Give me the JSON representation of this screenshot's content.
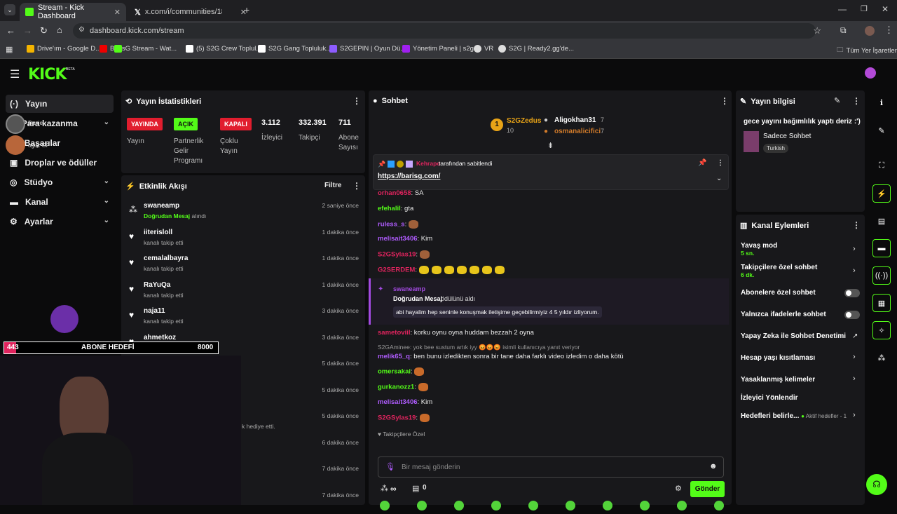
{
  "browser": {
    "tabs": [
      {
        "title": "Stream - Kick Dashboard",
        "active": true
      },
      {
        "title": "x.com/i/communities/18353197",
        "active": false
      }
    ],
    "url": "dashboard.kick.com/stream",
    "bookmarks": [
      "Drive'ım - Google D...",
      "BarisG Stream - Wat...",
      "(5) S2G Crew Toplul...",
      "S2G Gang Topluluk...",
      "S2GEPIN | Oyun Dü...",
      "Yönetim Paneli | s2g...",
      "VR",
      "S2G | Ready2.gg'de..."
    ],
    "all_bookmarks": "Tüm Yer İşaretleri"
  },
  "brand": {
    "logo": "KICK",
    "beta": "BETA",
    "accent": "#53fc18"
  },
  "sidebar": {
    "items": [
      {
        "label": "Yayın"
      },
      {
        "label": "Para kazanma"
      },
      {
        "label": "Başarılar"
      },
      {
        "label": "Droplar ve ödüller"
      },
      {
        "label": "Stüdyo"
      },
      {
        "label": "Kanal"
      },
      {
        "label": "Ayarlar"
      }
    ],
    "overlay_names": [
      "Daniel",
      "oguz GF"
    ]
  },
  "stats": {
    "title": "Yayın İstatistikleri",
    "badges": [
      {
        "value": "YAYINDA",
        "label": "Yayın",
        "color": "#e11d2e"
      },
      {
        "value": "AÇIK",
        "label": "Partnerlik Gelir Programı",
        "color": "#53fc18"
      },
      {
        "value": "KAPALI",
        "label": "Çoklu Yayın",
        "color": "#e11d2e"
      }
    ],
    "numbers": [
      {
        "value": "3.112",
        "label": "İzleyici"
      },
      {
        "value": "332.391",
        "label": "Takipçi"
      },
      {
        "value": "711",
        "label": "Abone Sayısı"
      }
    ]
  },
  "activity": {
    "title": "Etkinlik Akışı",
    "filter": "Filtre",
    "items": [
      {
        "user": "swaneamp",
        "highlight": "Doğrudan Mesaj",
        "sub": "alındı",
        "time": "2 saniye önce"
      },
      {
        "user": "iiterisloll",
        "sub": "kanalı takip etti",
        "time": "1 dakika önce"
      },
      {
        "user": "cemalalbayra",
        "sub": "kanalı takip etti",
        "time": "1 dakika önce"
      },
      {
        "user": "RaYuQa",
        "sub": "kanalı takip etti",
        "time": "1 dakika önce"
      },
      {
        "user": "naja11",
        "sub": "kanalı takip etti",
        "time": "3 dakika önce"
      },
      {
        "user": "ahmetkoz",
        "sub": "kanalı takip etti",
        "time": "3 dakika önce"
      },
      {
        "time": "5 dakika önce"
      },
      {
        "time": "5 dakika önce"
      },
      {
        "sub": "k hediye etti.",
        "time": "5 dakika önce"
      },
      {
        "time": "6 dakika önce"
      },
      {
        "time": "7 dakika önce"
      },
      {
        "time": "7 dakika önce"
      }
    ]
  },
  "goal": {
    "current": "443",
    "label": "ABONE HEDEFİ",
    "target": "8000"
  },
  "chat": {
    "title": "Sohbet",
    "top_gifters": [
      {
        "name": "S2GZedus",
        "count": "10",
        "rank": "1"
      },
      {
        "name": "Aligokhan31",
        "count": "7"
      },
      {
        "name": "osmanalicifici",
        "count": "7"
      }
    ],
    "pinned": {
      "by": "Kehrapo",
      "text": "tarafından sabitlendi",
      "link": "https://barisg.com/"
    },
    "messages": [
      {
        "user": "orhan0658",
        "text": "SA",
        "color": "#e0245e"
      },
      {
        "user": "efehalil",
        "text": "gta",
        "color": "#53fc18"
      },
      {
        "user": "ruless_s",
        "text": "",
        "color": "#b05cff"
      },
      {
        "user": "melisait3406",
        "text": "Kim",
        "color": "#b05cff"
      },
      {
        "user": "S2GSylas19",
        "text": "",
        "color": "#e0245e"
      },
      {
        "user": "G2SERDEM",
        "text": "",
        "color": "#e0245e"
      }
    ],
    "dm": {
      "user": "swaneamp",
      "title": "Doğrudan Mesaj",
      "title_suffix": "ödülünü aldı",
      "body": "abi hayalim hep seninle konuşmak iletişime geçebilirmiyiz 4 5 yıldır izliyorum."
    },
    "messages2": [
      {
        "user": "sametoviil",
        "text": "korku oynu oyna huddam bezzah 2 oyna",
        "color": "#e0245e"
      },
      {
        "reply": "S2GAminee: yok bee sustum artık iyy 😡😡😡 isimli kullanıcıya yanıt veriyor"
      },
      {
        "user": "melik65_q",
        "text": "ben bunu izledikten sonra bir tane daha farklı video izledim o daha kötü",
        "color": "#b05cff"
      },
      {
        "user": "omersakai",
        "text": "",
        "color": "#53fc18"
      },
      {
        "user": "gurkanozz1",
        "text": "",
        "color": "#53fc18"
      },
      {
        "user": "melisait3406",
        "text": "Kim",
        "color": "#b05cff"
      },
      {
        "user": "S2GSylas19",
        "text": "",
        "color": "#e0245e"
      }
    ],
    "followers_only": "Takipçilere Özel",
    "input_placeholder": "Bir mesaj gönderin",
    "send": "Gönder",
    "infinity": "∞",
    "zero": "0"
  },
  "stream_info": {
    "title": "Yayın bilgisi",
    "stream_title": "gece yayını bağımlılık yaptı deriz :')",
    "category": "Sadece Sohbet",
    "language": "Turkish"
  },
  "channel_actions": {
    "title": "Kanal Eylemleri",
    "items": [
      {
        "label": "Yavaş mod",
        "sub": "5 sn."
      },
      {
        "label": "Takipçilere özel sohbet",
        "sub": "6 dk."
      },
      {
        "label": "Abonelere özel sohbet"
      },
      {
        "label": "Yalnızca ifadelerle sohbet"
      },
      {
        "label": "Yapay Zeka ile Sohbet Denetimi"
      },
      {
        "label": "Hesap yaşı kısıtlaması"
      },
      {
        "label": "Yasaklanmış kelimeler"
      },
      {
        "label": "İzleyici Yönlendir"
      },
      {
        "label": "Hedefleri belirle...",
        "sub": "Aktif hedefler - 1"
      }
    ]
  }
}
